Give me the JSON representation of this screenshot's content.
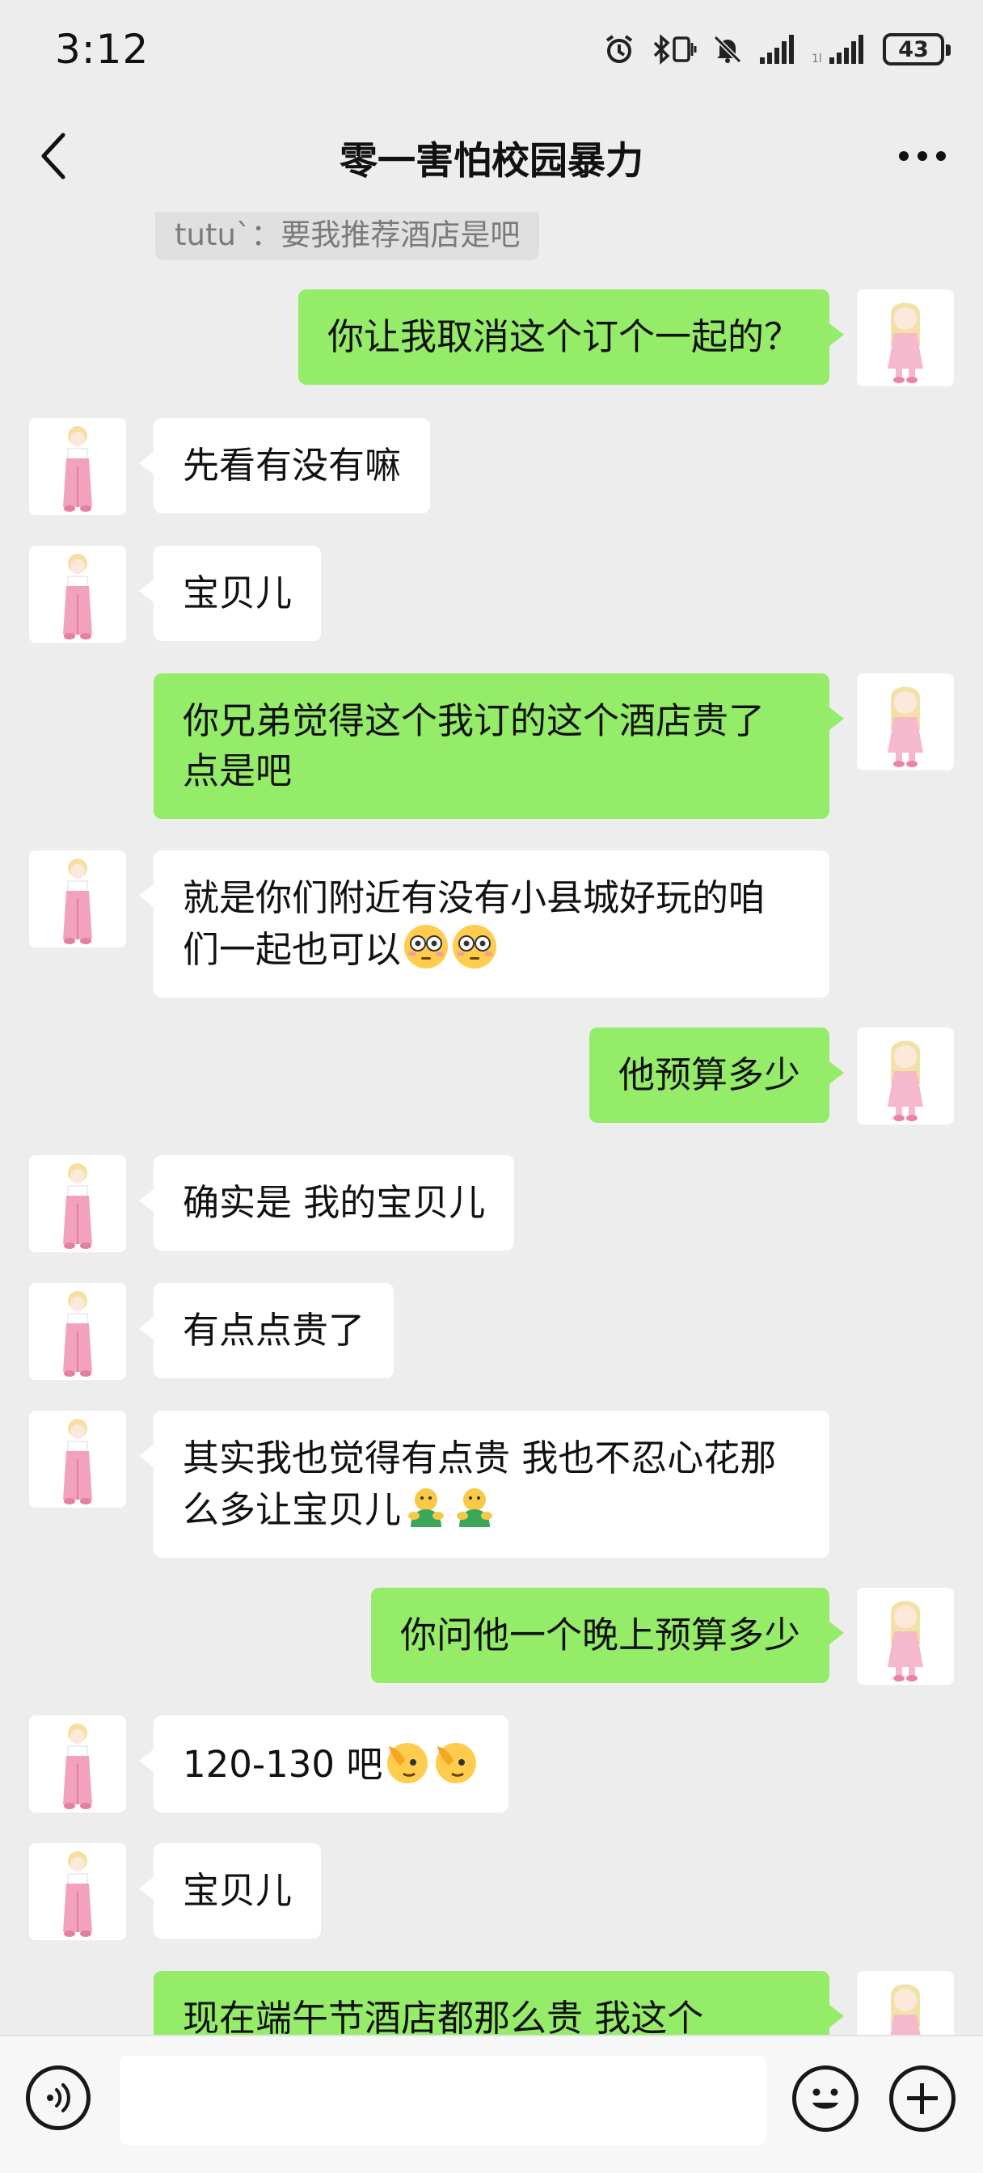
{
  "status": {
    "time": "3:12",
    "battery": "43",
    "icons": [
      "alarm-icon",
      "bluetooth-icon",
      "vibrate-icon",
      "mute-icon",
      "signal-icon",
      "signal2-icon",
      "battery-icon"
    ]
  },
  "header": {
    "title": "零一害怕校园暴力",
    "back_icon": "chevron-left-icon",
    "more_icon": "more-dots-icon"
  },
  "quote_text": "tutu`：要我推荐酒店是吧",
  "messages": [
    {
      "side": "right",
      "text": "你让我取消这个订个一起的？"
    },
    {
      "side": "left",
      "text": "先看有没有嘛"
    },
    {
      "side": "left",
      "text": "宝贝儿"
    },
    {
      "side": "right",
      "text": "你兄弟觉得这个我订的这个酒店贵了点是吧"
    },
    {
      "side": "left",
      "text": "就是你们附近有没有小县城好玩的咱们一起也可以",
      "emoji": "flushed-face-emoji x2"
    },
    {
      "side": "right",
      "text": "他预算多少"
    },
    {
      "side": "left",
      "text": "确实是 我的宝贝儿"
    },
    {
      "side": "left",
      "text": "有点点贵了"
    },
    {
      "side": "left",
      "text": "其实我也觉得有点贵 我也不忍心花那么多让宝贝儿",
      "emoji": "bunny-hug-emoji x2"
    },
    {
      "side": "right",
      "text": "你问他一个晚上预算多少"
    },
    {
      "side": "left",
      "text": "120-130 吧",
      "emoji": "facepalm-emoji x2"
    },
    {
      "side": "left",
      "text": "宝贝儿"
    },
    {
      "side": "right",
      "text": "现在端午节酒店都那么贵 我这个"
    }
  ],
  "input_bar": {
    "voice_icon": "voice-icon",
    "emoji_icon": "smiley-icon",
    "plus_icon": "plus-icon"
  },
  "colors": {
    "background": "#ededed",
    "sent_bubble": "#95ec69",
    "received_bubble": "#ffffff"
  }
}
